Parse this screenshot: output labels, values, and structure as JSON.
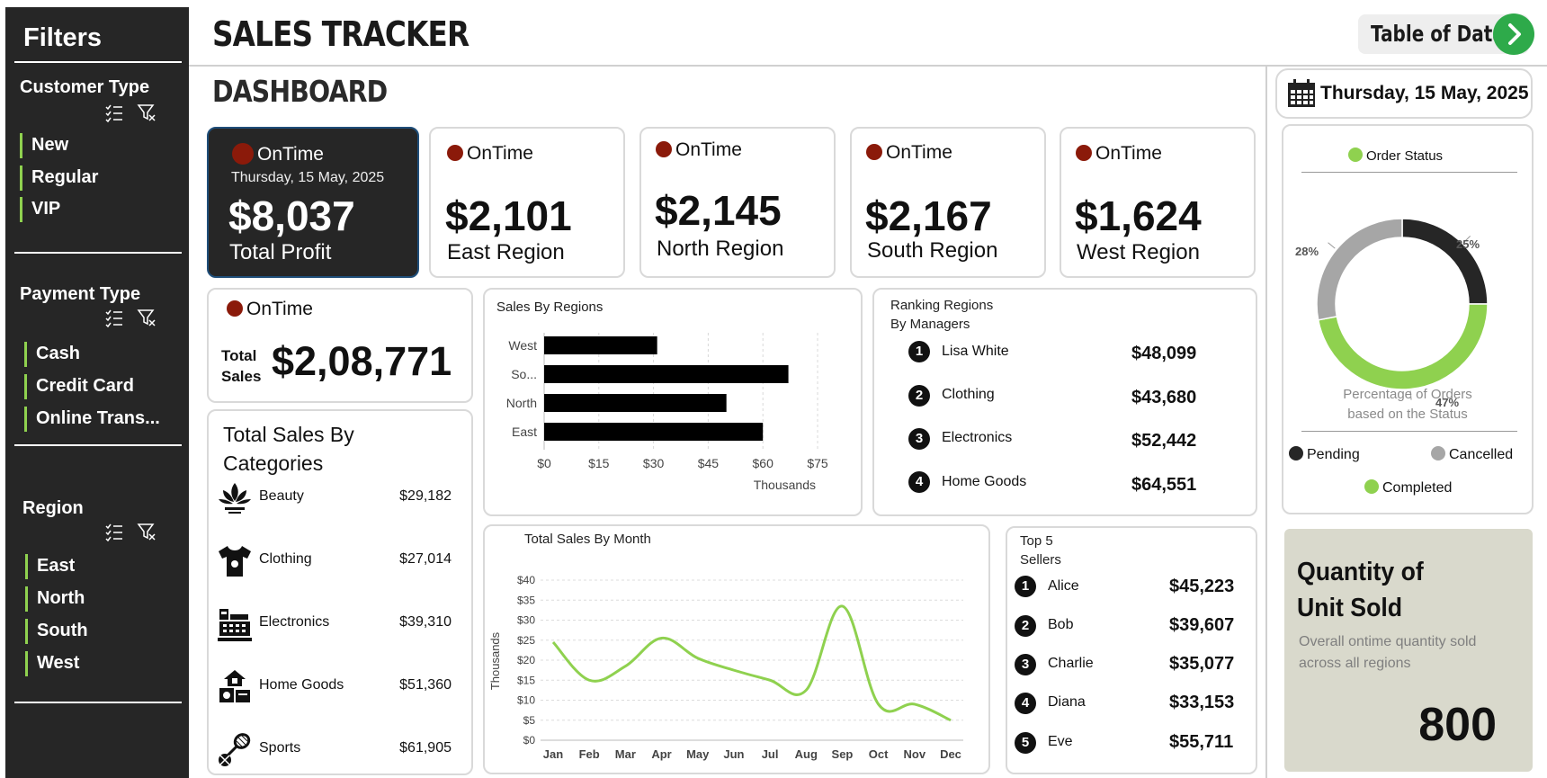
{
  "sidebar": {
    "title": "Filters",
    "customer_type": {
      "heading": "Customer Type",
      "items": [
        "New",
        "Regular",
        "VIP"
      ]
    },
    "payment_type": {
      "heading": "Payment Type",
      "items": [
        "Cash",
        "Credit Card",
        "Online Trans..."
      ]
    },
    "region": {
      "heading": "Region",
      "items": [
        "East",
        "North",
        "South",
        "West"
      ]
    },
    "accent_color": "#8fd14f"
  },
  "header": {
    "title": "SALES TRACKER",
    "subtitle": "DASHBOARD",
    "table_button": "Table of Data",
    "date": "Thursday, 15 May, 2025"
  },
  "kpis": {
    "status_label": "OnTime",
    "total": {
      "date": "Thursday, 15 May, 2025",
      "value": "$8,037",
      "label": "Total Profit"
    },
    "regions": [
      {
        "value": "$2,101",
        "label": "East Region"
      },
      {
        "value": "$2,145",
        "label": "North Region"
      },
      {
        "value": "$2,167",
        "label": "South Region"
      },
      {
        "value": "$1,624",
        "label": "West Region"
      }
    ],
    "total_sales": {
      "label_line1": "Total",
      "label_line2": "Sales",
      "value": "$2,08,771"
    }
  },
  "categories": {
    "title_line1": "Total Sales By",
    "title_line2": "Categories",
    "items": [
      {
        "name": "Beauty",
        "value": "$29,182",
        "icon": "lotus-icon"
      },
      {
        "name": "Clothing",
        "value": "$27,014",
        "icon": "tshirt-icon"
      },
      {
        "name": "Electronics",
        "value": "$39,310",
        "icon": "cash-register-icon"
      },
      {
        "name": "Home Goods",
        "value": "$51,360",
        "icon": "home-goods-icon"
      },
      {
        "name": "Sports",
        "value": "$61,905",
        "icon": "sports-icon"
      }
    ]
  },
  "ranking_managers": {
    "title_line1": "Ranking Regions",
    "title_line2": "By Managers",
    "items": [
      {
        "rank": "1",
        "name": "Lisa White",
        "value": "$48,099"
      },
      {
        "rank": "2",
        "name": "Clothing",
        "value": "$43,680"
      },
      {
        "rank": "3",
        "name": "Electronics",
        "value": "$52,442"
      },
      {
        "rank": "4",
        "name": "Home Goods",
        "value": "$64,551"
      }
    ]
  },
  "top_sellers": {
    "title_line1": "Top 5",
    "title_line2": "Sellers",
    "items": [
      {
        "rank": "1",
        "name": "Alice",
        "value": "$45,223"
      },
      {
        "rank": "2",
        "name": "Bob",
        "value": "$39,607"
      },
      {
        "rank": "3",
        "name": "Charlie",
        "value": "$35,077"
      },
      {
        "rank": "4",
        "name": "Diana",
        "value": "$33,153"
      },
      {
        "rank": "5",
        "name": "Eve",
        "value": "$55,711"
      }
    ]
  },
  "order_status": {
    "legend_title": "Order Status",
    "caption_line1": "Percentage of Orders",
    "caption_line2": "based on the Status",
    "legend": [
      "Pending",
      "Cancelled",
      "Completed"
    ]
  },
  "quantity": {
    "title_line1": "Quantity of",
    "title_line2": "Unit Sold",
    "desc_line1": "Overall ontime quantity sold",
    "desc_line2": "across all regions",
    "value": "800"
  },
  "chart_data": [
    {
      "type": "bar",
      "orientation": "horizontal",
      "title": "Sales By Regions",
      "categories": [
        "West",
        "So...",
        "North",
        "East"
      ],
      "values": [
        31,
        67,
        50,
        60
      ],
      "xlim": [
        0,
        75
      ],
      "xticks": [
        "$0",
        "$15",
        "$30",
        "$45",
        "$60",
        "$75"
      ],
      "xlabel": "Thousands",
      "grid": true,
      "color": "#000000"
    },
    {
      "type": "line",
      "title": "Total Sales By Month",
      "x": [
        "Jan",
        "Feb",
        "Mar",
        "Apr",
        "May",
        "Jun",
        "Jul",
        "Aug",
        "Sep",
        "Oct",
        "Nov",
        "Dec"
      ],
      "values": [
        24.5,
        15,
        18.5,
        25.5,
        20.5,
        17.5,
        15,
        12.5,
        33.5,
        9,
        9,
        5
      ],
      "ylim": [
        0,
        40
      ],
      "yticks": [
        "$0",
        "$5",
        "$10",
        "$15",
        "$20",
        "$25",
        "$30",
        "$35",
        "$40"
      ],
      "ylabel": "Thousands",
      "grid": true,
      "color": "#8fd14f"
    },
    {
      "type": "pie",
      "donut": true,
      "title": "Order Status",
      "categories": [
        "Pending",
        "Completed",
        "Cancelled"
      ],
      "values": [
        25,
        47,
        28
      ],
      "labels": [
        "25%",
        "47%",
        "28%"
      ],
      "colors": [
        "#262626",
        "#8fd14f",
        "#a6a6a6"
      ]
    }
  ]
}
